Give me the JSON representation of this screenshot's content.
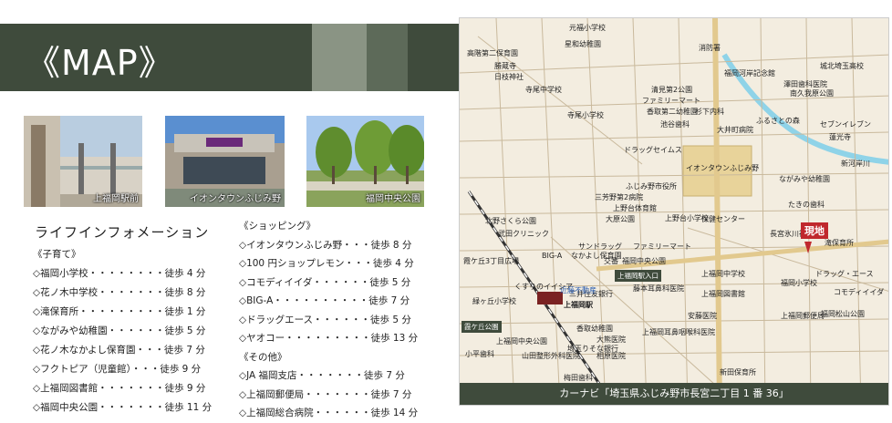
{
  "header": {
    "title": "《MAP》"
  },
  "photos": [
    {
      "caption": "上福岡駅前"
    },
    {
      "caption": "イオンタウンふじみ野"
    },
    {
      "caption": "福岡中央公園"
    }
  ],
  "life": {
    "heading": "ライフインフォメーション",
    "groups": [
      {
        "title": "《子育て》",
        "items": [
          "◇福岡小学校・・・・・・・・徒歩 4 分",
          "◇花ノ木中学校・・・・・・・徒歩 8 分",
          "◇滝保育所・・・・・・・・・徒歩 1 分",
          "◇ながみや幼稚園・・・・・・徒歩 5 分",
          "◇花ノ木なかよし保育園・・・徒歩 7 分",
          "◇フクトピア（児童館）・・・徒歩 9 分",
          "◇上福岡図書館・・・・・・・徒歩 9 分",
          "◇福岡中央公園・・・・・・・徒歩 11 分"
        ]
      },
      {
        "title": "《ショッピング》",
        "items": [
          "◇イオンタウンふじみ野・・・徒歩 8 分",
          "◇100 円ショップレモン・・・徒歩 4 分",
          "◇コモディイイダ・・・・・・徒歩 5 分",
          "◇BIG-A・・・・・・・・・・徒歩 7 分",
          "◇ドラッグエース・・・・・・徒歩 5 分",
          "◇ヤオコー・・・・・・・・・徒歩 13 分"
        ]
      },
      {
        "title": "《その他》",
        "items": [
          "◇JA 福岡支店・・・・・・・徒歩 7 分",
          "◇上福岡郵便局・・・・・・・徒歩 7 分",
          "◇上福岡総合病院・・・・・・徒歩 14 分"
        ]
      }
    ]
  },
  "map": {
    "carnavi": "カーナビ「埼玉県ふじみ野市長宮二丁目 1 番 36」",
    "genchi": "現地",
    "labels": [
      "元福小学校",
      "星和幼稚園",
      "高階第二保育園",
      "勝蔵寺",
      "日枝神社",
      "寺尾中学校",
      "清見第2公園",
      "ファミリーマート",
      "香取第二幼稚園",
      "寺尾小学校",
      "池谷歯科",
      "杉下内科",
      "消防署",
      "福岡河岸記念館",
      "城北埼玉高校",
      "澤田歯科医院",
      "南久我原公園",
      "新河岸川",
      "ふるさとの森",
      "セブンイレブン",
      "蓮光寺",
      "大井町病院",
      "ドラッグセイムス",
      "イオンタウンふじみ野",
      "ふじみ野市役所",
      "三芳野第2病院",
      "上野台体育館",
      "大原公園",
      "上野台小学校",
      "保健センター",
      "ながみや幼稚園",
      "たきの歯科",
      "北野さくら公園",
      "武田クリニック",
      "長宮氷川神社",
      "滝保育所",
      "サンドラッグ",
      "ファミリーマート",
      "BIG-A",
      "なかよし保育園",
      "交番",
      "福岡中央公園",
      "上福岡駅入口",
      "霞ケ丘3丁目広場",
      "くすりのイイシア",
      "上福岡駅",
      "三井住友銀行",
      "緑ヶ丘小学校",
      "藤本耳鼻科医院",
      "上福岡中学校",
      "上福岡図書館",
      "コモディイイダ",
      "福岡小学校",
      "ドラッグ・エース",
      "上福岡郵便局",
      "香取幼稚園",
      "安藤医院",
      "上福岡耳鼻咽喉科医院",
      "大熊医院",
      "埼玉りそな銀行",
      "相原医院",
      "山田整形外科医院",
      "福岡松山公園",
      "新田保育所",
      "梅田歯科",
      "小平歯科",
      "上福岡中央公園",
      "霞ケ丘公園",
      "近藤不動産"
    ]
  }
}
